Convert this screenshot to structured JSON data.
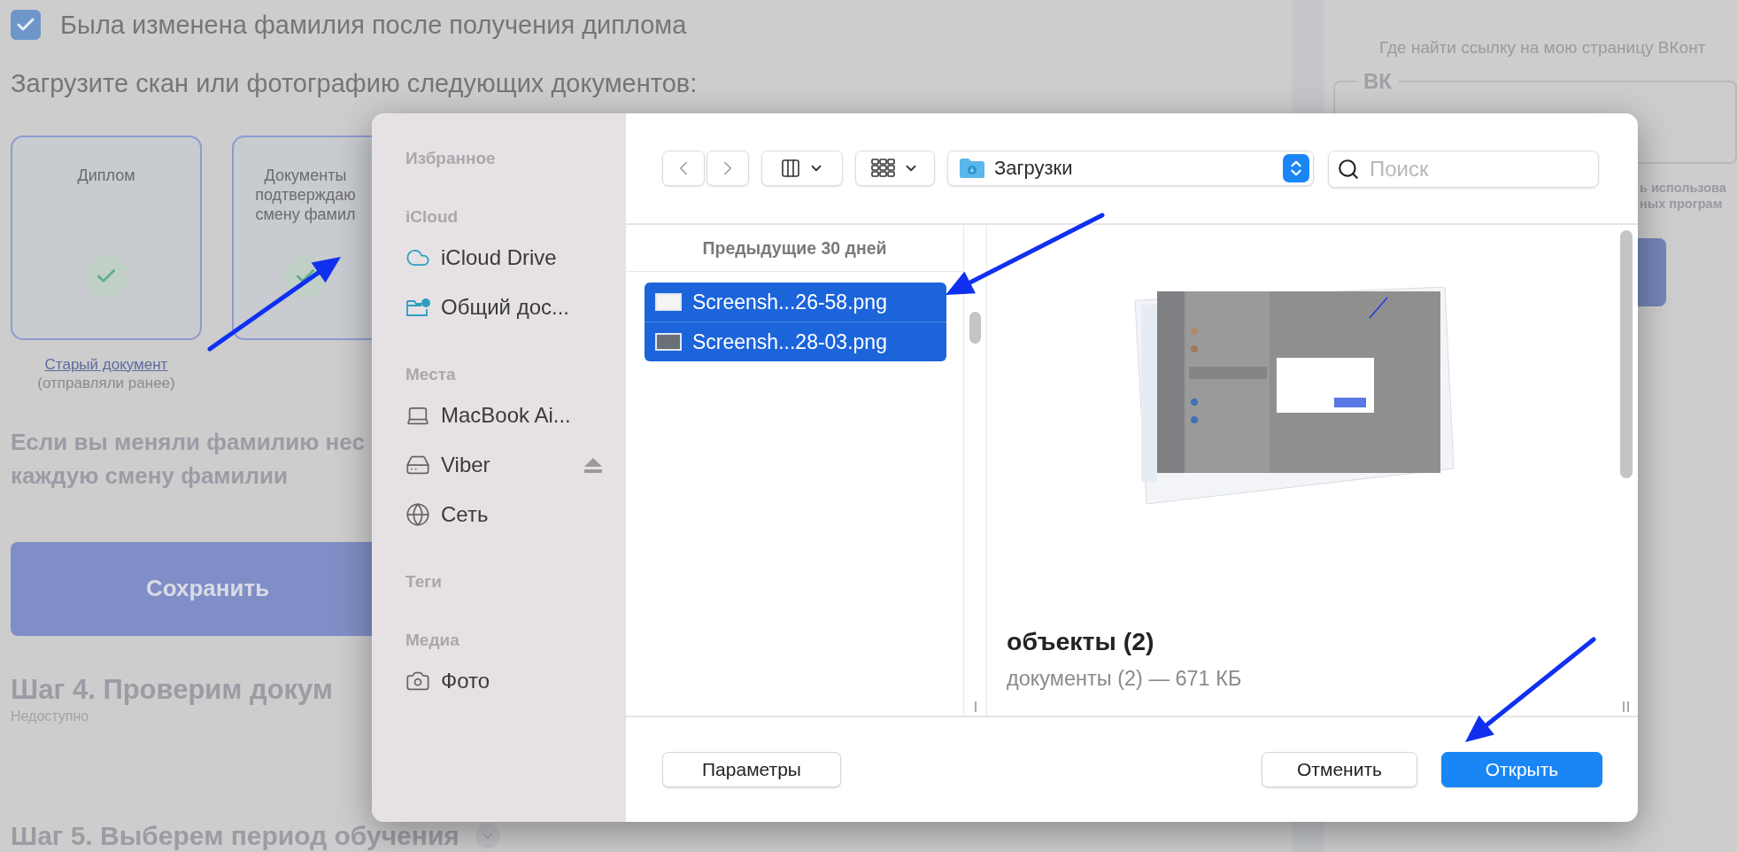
{
  "background_page": {
    "name_change": {
      "label": "Была изменена фамилия после получения диплома",
      "checked": true
    },
    "upload_prompt": "Загрузите скан или фотографию следующих документов:",
    "documents": [
      {
        "lines": [
          "Диплом"
        ],
        "uploaded": true
      },
      {
        "lines": [
          "Документы",
          "подтверждаю",
          "смену фамил"
        ],
        "uploaded": true
      }
    ],
    "old_document_link": "Старый документ",
    "old_document_note": "(отправляли ранее)",
    "note_lines": [
      "Если вы меняли фамилию нес",
      "каждую смену фамилии"
    ],
    "save_button": "Сохранить",
    "steps": [
      {
        "title": "Шаг 4. Проверим докум",
        "status": "Недоступно"
      },
      {
        "title": "Шаг 5. Выберем период обучения",
        "expandable": true
      }
    ]
  },
  "right_panel": {
    "help_link": "Где найти ссылку на мою страницу ВКонт",
    "vk_field": {
      "label": "ВК"
    },
    "consent_lines": [
      "ь использова",
      "ных програм"
    ]
  },
  "dialog": {
    "sidebar": {
      "sections": [
        {
          "title": "Избранное"
        },
        {
          "title": "iCloud",
          "items": [
            {
              "label": "iCloud Drive",
              "kind": "cloud",
              "ejectable": false
            },
            {
              "label": "Общий дос...",
              "kind": "shared",
              "ejectable": false
            }
          ]
        },
        {
          "title": "Места",
          "items": [
            {
              "label": "MacBook Ai...",
              "kind": "laptop",
              "ejectable": false
            },
            {
              "label": "Viber",
              "kind": "drive",
              "ejectable": true
            },
            {
              "label": "Сеть",
              "kind": "network",
              "ejectable": false
            }
          ]
        },
        {
          "title": "Теги"
        },
        {
          "title": "Медиа",
          "items": [
            {
              "label": "Фото",
              "kind": "camera",
              "ejectable": false
            }
          ]
        }
      ]
    },
    "toolbar": {
      "location": "Загрузки",
      "search": {
        "placeholder": "Поиск"
      }
    },
    "file_list": {
      "group": "Предыдущие 30 дней",
      "files": [
        {
          "name": "Screensh...26-58.png",
          "selected": true
        },
        {
          "name": "Screensh...28-03.png",
          "selected": true
        }
      ]
    },
    "preview": {
      "title": "объекты (2)",
      "details": "документы (2) — 671 КБ"
    },
    "options_button": "Параметры",
    "buttons": [
      {
        "label": "Отменить",
        "default": false
      },
      {
        "label": "Открыть",
        "default": true
      }
    ]
  }
}
